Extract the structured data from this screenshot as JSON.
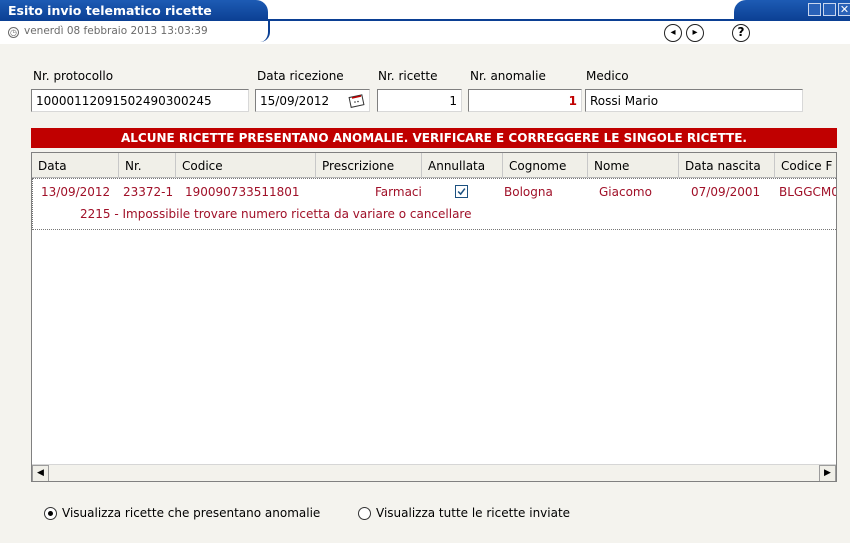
{
  "window": {
    "title": "Esito invio telematico ricette",
    "datetime": "venerdì 08 febbraio 2013   13:03:39"
  },
  "form": {
    "protocollo_label": "Nr. protocollo",
    "protocollo_value": "10000112091502490300245",
    "data_ricezione_label": "Data ricezione",
    "data_ricezione_value": "15/09/2012",
    "nr_ricette_label": "Nr. ricette",
    "nr_ricette_value": "1",
    "nr_anomalie_label": "Nr. anomalie",
    "nr_anomalie_value": "1",
    "medico_label": "Medico",
    "medico_value": "Rossi Mario"
  },
  "alert": "ALCUNE RICETTE PRESENTANO ANOMALIE. VERIFICARE E CORREGGERE LE SINGOLE RICETTE.",
  "table": {
    "columns": [
      "Data",
      "Nr.",
      "Codice",
      "Prescrizione",
      "Annullata",
      "Cognome",
      "Nome",
      "Data nascita",
      "Codice F"
    ],
    "rows": [
      {
        "data": "13/09/2012",
        "nr": "23372-1",
        "codice": "190090733511801",
        "prescrizione": "Farmaci",
        "annullata": true,
        "cognome": "Bologna",
        "nome": "Giacomo",
        "data_nascita": "07/09/2001",
        "codice_fiscale": "BLGGCM0",
        "error": "2215 - Impossibile trovare numero ricetta da variare o cancellare"
      }
    ]
  },
  "filters": {
    "option_anomalie": "Visualizza ricette che presentano anomalie",
    "option_tutte": "Visualizza tutte le ricette inviate",
    "selected": "anomalie"
  },
  "colors": {
    "title_blue": "#0b3f93",
    "alert_red": "#c00000",
    "row_text": "#a01028"
  }
}
